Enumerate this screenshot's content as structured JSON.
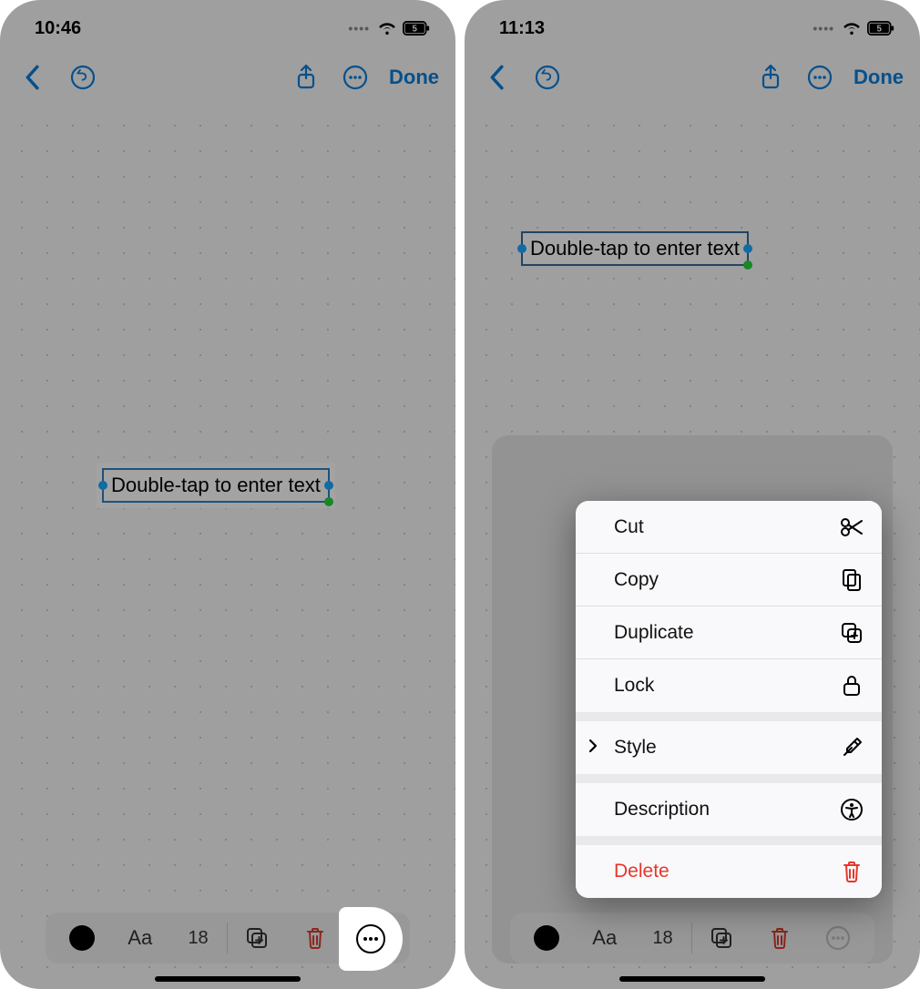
{
  "status": {
    "time_left": "10:46",
    "time_right": "11:13",
    "battery": "5"
  },
  "nav": {
    "done": "Done"
  },
  "text_box": {
    "placeholder": "Double-tap to enter text"
  },
  "toolbar": {
    "font_label": "Aa",
    "font_size": "18"
  },
  "context_menu": {
    "items": [
      {
        "label": "Cut",
        "icon": "scissors-icon"
      },
      {
        "label": "Copy",
        "icon": "docs-icon"
      },
      {
        "label": "Duplicate",
        "icon": "duplicate-plus-icon"
      },
      {
        "label": "Lock",
        "icon": "lock-icon"
      },
      {
        "label": "Style",
        "icon": "eyedropper-icon",
        "chev": true
      },
      {
        "label": "Description",
        "icon": "accessibility-icon"
      },
      {
        "label": "Delete",
        "icon": "trash-icon",
        "destructive": true
      }
    ]
  }
}
